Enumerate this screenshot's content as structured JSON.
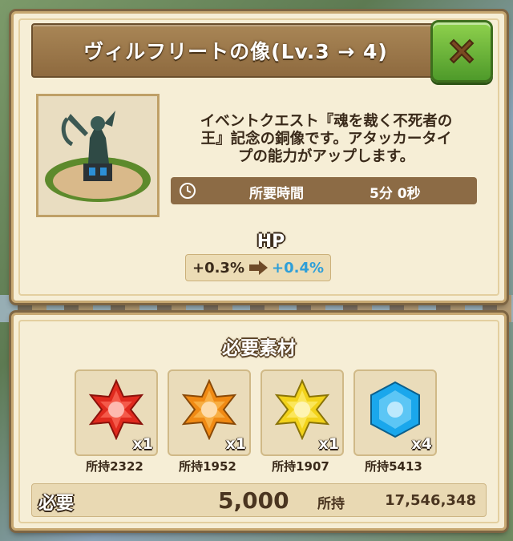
{
  "dialog": {
    "title": "ヴィルフリートの像(Lv.3 → 4)",
    "close_icon": "close-x-icon",
    "description": "イベントクエスト『魂を裁く不死者の\n王』記念の銅像です。アタッカータイ\nプの能力がアップします。",
    "time": {
      "icon": "clock-icon",
      "label": "所要時間",
      "value": "5分 0秒"
    },
    "stat": {
      "name": "HP",
      "old": "+0.3%",
      "arrow_icon": "right-arrow-icon",
      "new": "+0.4%"
    }
  },
  "materials": {
    "title": "必要素材",
    "items": [
      {
        "icon": "red-star-crystal-icon",
        "color": "#e02a1e",
        "qty": "x1",
        "owned": "所持2322"
      },
      {
        "icon": "orange-star-crystal-icon",
        "color": "#f08a14",
        "qty": "x1",
        "owned": "所持1952"
      },
      {
        "icon": "yellow-star-crystal-icon",
        "color": "#f2d21a",
        "qty": "x1",
        "owned": "所持1907"
      },
      {
        "icon": "blue-hexagon-crystal-icon",
        "color": "#1aa7ec",
        "qty": "x4",
        "owned": "所持5413"
      }
    ]
  },
  "cost": {
    "label": "必要",
    "value": "5,000",
    "owned_label": "所持",
    "owned_value": "17,546,348"
  },
  "colors": {
    "accent_green": "#6fb53a",
    "stat_up": "#2f9fd8",
    "frame_brown": "#8e6a3f"
  }
}
